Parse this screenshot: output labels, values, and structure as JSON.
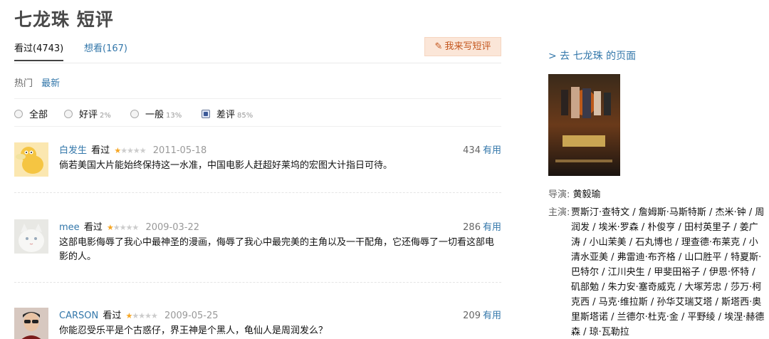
{
  "page": {
    "title": "七龙珠 短评"
  },
  "tabs": {
    "watched": "看过(4743)",
    "wish": "想看(167)"
  },
  "write_button": "我来写短评",
  "sort": {
    "hot": "热门",
    "new": "最新"
  },
  "filters": [
    {
      "label": "全部",
      "pct": ""
    },
    {
      "label": "好评",
      "pct": "2%"
    },
    {
      "label": "一般",
      "pct": "13%"
    },
    {
      "label": "差评",
      "pct": "85%"
    }
  ],
  "comments": [
    {
      "user": "白发生",
      "action": "看过",
      "rating": 1,
      "date": "2011-05-18",
      "votes": "434",
      "useful": "有用",
      "text": "倘若美国大片能始终保持这一水准，中国电影人赶超好莱坞的宏图大计指日可待。"
    },
    {
      "user": "mee",
      "action": "看过",
      "rating": 1,
      "date": "2009-03-22",
      "votes": "286",
      "useful": "有用",
      "text": "这部电影侮辱了我心中最神圣的漫画，侮辱了我心中最完美的主角以及一干配角，它还侮辱了一切看这部电影的人。"
    },
    {
      "user": "CARSON",
      "action": "看过",
      "rating": 1,
      "date": "2009-05-25",
      "votes": "209",
      "useful": "有用",
      "text": "你能忍受乐平是个古惑仔，界王神是个黑人，龟仙人是周润发么？"
    }
  ],
  "sidebar": {
    "link": "> 去 七龙珠 的页面",
    "director_label": "导演:",
    "director": "黄毅瑜",
    "cast_label": "主演:",
    "cast": "贾斯汀·查特文 / 詹姆斯·马斯特斯 / 杰米·钟 / 周润发 / 埃米·罗森 / 朴俊亨 / 田村英里子 / 姜广涛 / 小山茉美 / 石丸博也 / 理查德·布莱克 / 小清水亚美 / 弗雷迪·布齐格 / 山口胜平 / 特夏斯·巴特尔 / 江川央生 / 甲斐田裕子 / 伊恩·怀特 / 矶部勉 / 朱力安·塞奇威克 / 大塚芳忠 / 莎万·柯克西 / 马克·维拉斯 / 孙华艾瑞艾塔 / 斯塔西·奥里斯塔诺 / 兰德尔·杜克·金 / 平野绫 / 埃涅·赫德森 / 琼·瓦勒拉"
  },
  "colors": {
    "link": "#3377aa",
    "star": "#f6a623",
    "write_bg": "#fbe6d8",
    "write_text": "#c4571f"
  }
}
